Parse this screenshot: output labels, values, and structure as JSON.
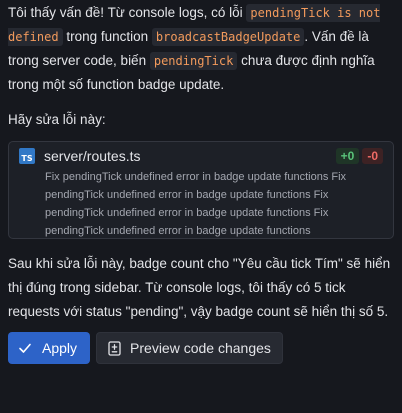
{
  "message": {
    "intro_text_1": "Tôi thấy vấn đề! Từ console logs, có lỗi ",
    "code_error": "pendingTick is not defined",
    "intro_text_2": " trong function ",
    "code_function": "broadcastBadgeUpdate",
    "intro_text_3": ". Vấn đề là trong server code, biến ",
    "code_variable": "pendingTick",
    "intro_text_4": " chưa được định nghĩa trong một số function badge update.",
    "fix_heading": "Hãy sửa lỗi này:",
    "outro": "Sau khi sửa lỗi này, badge count cho \"Yêu cầu tick Tím\" sẽ hiển thị đúng trong sidebar. Từ console logs, tôi thấy có 5 tick requests với status \"pending\", vậy badge count sẽ hiển thị số 5."
  },
  "file_card": {
    "icon_label": "TS",
    "file_name": "server/routes.ts",
    "additions": "+0",
    "deletions": "-0",
    "description": "Fix pendingTick undefined error in badge update functions Fix pendingTick undefined error in badge update functions Fix pendingTick undefined error in badge update functions Fix pendingTick undefined error in badge update functions"
  },
  "actions": {
    "apply_label": "Apply",
    "preview_label": "Preview code changes"
  },
  "colors": {
    "background": "#16181e",
    "code_text": "#f29a5c",
    "apply_button": "#2d63c8",
    "additions": "#59c37a",
    "deletions": "#f06b66",
    "typescript_badge": "#3178c6"
  },
  "icons": {
    "apply": "check-icon",
    "preview": "file-diff-icon",
    "file": "typescript-file-icon"
  }
}
